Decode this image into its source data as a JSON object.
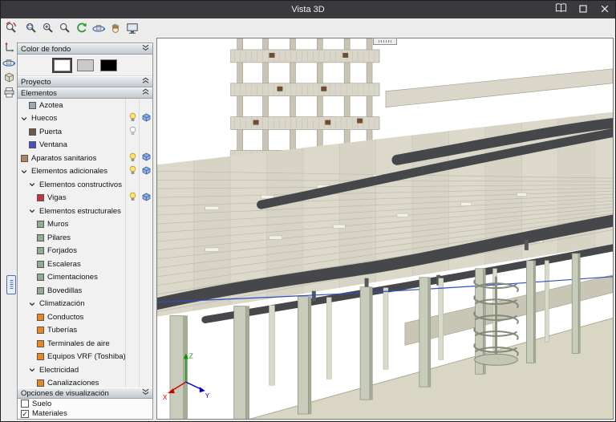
{
  "window": {
    "title": "Vista 3D",
    "controls": [
      {
        "name": "docs",
        "icon": "book"
      },
      {
        "name": "maximize",
        "icon": "maximize"
      },
      {
        "name": "close",
        "icon": "close"
      }
    ]
  },
  "toolbar": {
    "icons": [
      "zoom-rotate",
      "zoom-window",
      "zoom-inout",
      "zoom-plain",
      "redraw",
      "orbit",
      "pan",
      "screen"
    ]
  },
  "left_rail": {
    "icons": [
      "axes",
      "orbit-small",
      "cube",
      "print"
    ]
  },
  "sidebar": {
    "background_panel": {
      "title": "Color de fondo",
      "chev": "down",
      "swatches": [
        {
          "name": "white",
          "color": "#ffffff",
          "selected": true
        },
        {
          "name": "gray",
          "color": "#c9c9c9",
          "selected": false
        },
        {
          "name": "black",
          "color": "#000000",
          "selected": false
        }
      ]
    },
    "project_panel": {
      "title": "Proyecto",
      "chev": "up"
    },
    "elements_panel": {
      "title": "Elementos",
      "chev": "up"
    },
    "tree": [
      {
        "label": "Azotea",
        "level": 1,
        "swatch": "#9fa8b0"
      },
      {
        "label": "Huecos",
        "level": 0,
        "group": true,
        "bulb": "on",
        "cube": true
      },
      {
        "label": "Puerta",
        "level": 1,
        "swatch": "#6b5a49",
        "bulb": "off"
      },
      {
        "label": "Ventana",
        "level": 1,
        "swatch": "#4d4dc0"
      },
      {
        "label": "Aparatos sanitarios",
        "level": 0,
        "swatch": "#b08662",
        "bulb": "on",
        "cube": true
      },
      {
        "label": "Elementos adicionales",
        "level": 0,
        "group": true,
        "bulb": "on",
        "cube": true
      },
      {
        "label": "Elementos constructivos",
        "level": 1,
        "group": true
      },
      {
        "label": "Vigas",
        "level": 2,
        "swatch": "#c93434",
        "bulb": "on",
        "cube": true
      },
      {
        "label": "Elementos estructurales",
        "level": 1,
        "group": true
      },
      {
        "label": "Muros",
        "level": 2,
        "swatch": "#93ab93"
      },
      {
        "label": "Pilares",
        "level": 2,
        "swatch": "#93ab93"
      },
      {
        "label": "Forjados",
        "level": 2,
        "swatch": "#93ab93"
      },
      {
        "label": "Escaleras",
        "level": 2,
        "swatch": "#93ab93"
      },
      {
        "label": "Cimentaciones",
        "level": 2,
        "swatch": "#93ab93"
      },
      {
        "label": "Bovedillas",
        "level": 2,
        "swatch": "#93ab93"
      },
      {
        "label": "Climatización",
        "level": 1,
        "group": true
      },
      {
        "label": "Conductos",
        "level": 2,
        "swatch": "#e8871f"
      },
      {
        "label": "Tuberías",
        "level": 2,
        "swatch": "#e8871f"
      },
      {
        "label": "Terminales de aire",
        "level": 2,
        "swatch": "#e8871f"
      },
      {
        "label": "Equipos VRF (Toshiba)",
        "level": 2,
        "swatch": "#e8871f"
      },
      {
        "label": "Electricidad",
        "level": 1,
        "group": true
      },
      {
        "label": "Canalizaciones",
        "level": 2,
        "swatch": "#e8871f"
      }
    ],
    "options_panel": {
      "title": "Opciones de visualización",
      "chev": "down",
      "items": [
        {
          "label": "Suelo",
          "checked": false
        },
        {
          "label": "Materiales",
          "checked": true
        }
      ]
    }
  },
  "viewport": {
    "axes": {
      "x": "X",
      "y": "Y",
      "z": "Z"
    }
  }
}
